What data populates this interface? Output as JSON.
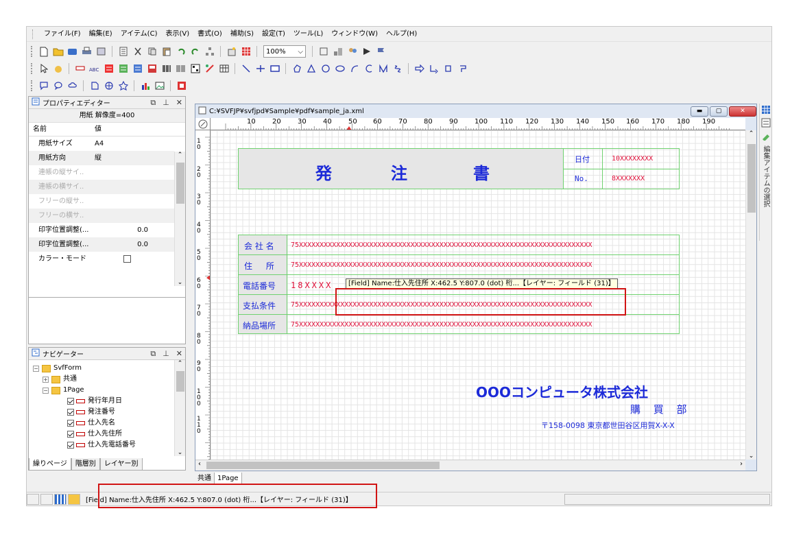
{
  "menu": [
    "ファイル(F)",
    "編集(E)",
    "アイテム(C)",
    "表示(V)",
    "書式(O)",
    "補助(S)",
    "設定(T)",
    "ツール(L)",
    "ウィンドウ(W)",
    "ヘルプ(H)"
  ],
  "zoom": "100%",
  "props": {
    "title": "プロパティエディター",
    "subtitle": "用紙 解像度=400",
    "head_name": "名前",
    "head_value": "値",
    "rows": [
      {
        "name": "用紙サイズ",
        "value": "A4",
        "disabled": false
      },
      {
        "name": "用紙方向",
        "value": "縦",
        "disabled": false
      },
      {
        "name": "連帳の縦サイ..",
        "value": "",
        "disabled": true
      },
      {
        "name": "連帳の横サイ..",
        "value": "",
        "disabled": true
      },
      {
        "name": "フリーの縦サ..",
        "value": "",
        "disabled": true
      },
      {
        "name": "フリーの横サ..",
        "value": "",
        "disabled": true
      },
      {
        "name": "印字位置調整(...",
        "value": "0.0",
        "disabled": false
      },
      {
        "name": "印字位置調整(...",
        "value": "0.0",
        "disabled": false
      },
      {
        "name": "カラー・モード",
        "value": "",
        "disabled": false
      }
    ]
  },
  "nav": {
    "title": "ナビゲーター",
    "root": "SvfForm",
    "common": "共通",
    "page": "1Page",
    "fields": [
      "発行年月日",
      "発注番号",
      "仕入先名",
      "仕入先住所",
      "仕入先電話番号"
    ],
    "tabs": [
      "繰りページ",
      "階層別",
      "レイヤー別"
    ]
  },
  "doc": {
    "path": "C:¥SVFJP¥svfjpd¥Sample¥pdf¥sample_ja.xml",
    "ruler_h": [
      "10",
      "20",
      "30",
      "40",
      "50",
      "60",
      "70",
      "80",
      "90",
      "100",
      "110",
      "120",
      "130",
      "140",
      "150",
      "160",
      "170",
      "180",
      "190"
    ],
    "ruler_v": [
      "1\n0",
      "2\n0",
      "3\n0",
      "4\n0",
      "5\n0",
      "6\n0",
      "7\n0",
      "8\n0",
      "9\n0",
      "1\n0\n0",
      "1\n1\n0"
    ],
    "title_chars": [
      "発",
      "注",
      "書"
    ],
    "date_label": "日付",
    "date_value": "10XXXXXXXX",
    "no_label": "No.",
    "no_value": "8XXXXXXX",
    "rows": [
      {
        "label": "会 社 名",
        "value": "75XXXXXXXXXXXXXXXXXXXXXXXXXXXXXXXXXXXXXXXXXXXXXXXXXXXXXXXXXXXXXXXXXXXXXXX"
      },
      {
        "label": "住 所",
        "value": "75XXXXXXXXXXXXXXXXXXXXXXXXXXXXXXXXXXXXXXXXXXXXXXXXXXXXXXXXXXXXXXXXXXXXXXX"
      },
      {
        "label": "電話番号",
        "value": "18XXXX"
      },
      {
        "label": "支払条件",
        "value": "75XXXXXXXXXXXXXXXXXXXXXXXXXXXXXXXXXXXXXXXXXXXXXXXXXXXXXXXXXXXXXXXXXXXXXXX"
      },
      {
        "label": "納品場所",
        "value": "75XXXXXXXXXXXXXXXXXXXXXXXXXXXXXXXXXXXXXXXXXXXXXXXXXXXXXXXXXXXXXXXXXXXXXXX"
      }
    ],
    "tooltip": "[Field] Name:仕入先住所 X:462.5 Y:807.0 (dot) 桁...【レイヤー: フィールド (31)】",
    "company": "OOOコンピュータ株式会社",
    "dept": "購 買 部",
    "address": "〒158-0098 東京都世田谷区用賀X-X-X",
    "tabs": [
      "共通",
      "1Page"
    ]
  },
  "right_panel": "編集アイテムの選択",
  "status": "[Field] Name:仕入先住所 X:462.5 Y:807.0 (dot) 桁...【レイヤー: フィールド (31)】",
  "colors": {
    "blue": "#1c2ad8",
    "red": "#e0103a",
    "green": "#6fd16f",
    "highlight": "#d11414"
  }
}
